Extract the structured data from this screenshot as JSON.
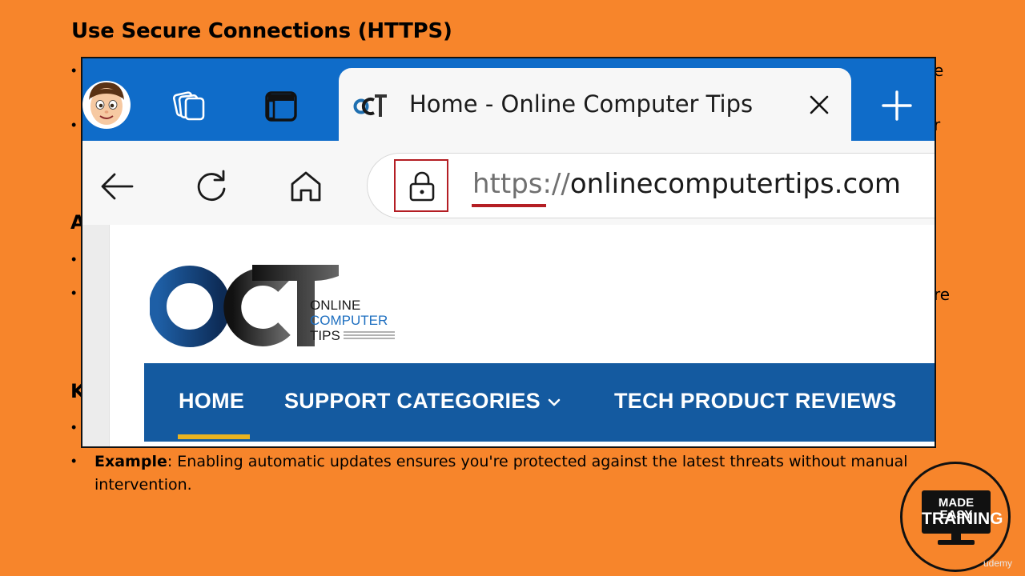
{
  "slide": {
    "heading": "Use Secure Connections (HTTPS)",
    "peek_texts": {
      "right_1": "e",
      "right_2": "r",
      "left_a": "A",
      "right_3": "re",
      "left_k": "K"
    },
    "example_label": "Example",
    "example_text": ": Enabling automatic updates ensures you're protected against the latest threats without manual intervention."
  },
  "browser": {
    "tab": {
      "favicon": "oct-favicon-icon",
      "title": "Home - Online Computer Tips",
      "close_icon": "close-icon"
    },
    "address": {
      "scheme": "https://",
      "host": "onlinecomputertips.com",
      "lock_icon": "lock-icon"
    },
    "site": {
      "logo_lines": [
        "ONLINE",
        "COMPUTER",
        "TIPS"
      ],
      "nav": [
        {
          "label": "HOME"
        },
        {
          "label": "SUPPORT CATEGORIES"
        },
        {
          "label": "TECH PRODUCT REVIEWS"
        }
      ]
    }
  },
  "branding": {
    "badge_line1": "MADE EASY",
    "badge_line2": "TRAINING",
    "watermark": "udemy"
  },
  "colors": {
    "slide_bg": "#f7852b",
    "tabstrip": "#0f6cc9",
    "nav_bar": "#145aa0",
    "accent_red": "#b41e24",
    "nav_underline": "#e9b320"
  }
}
